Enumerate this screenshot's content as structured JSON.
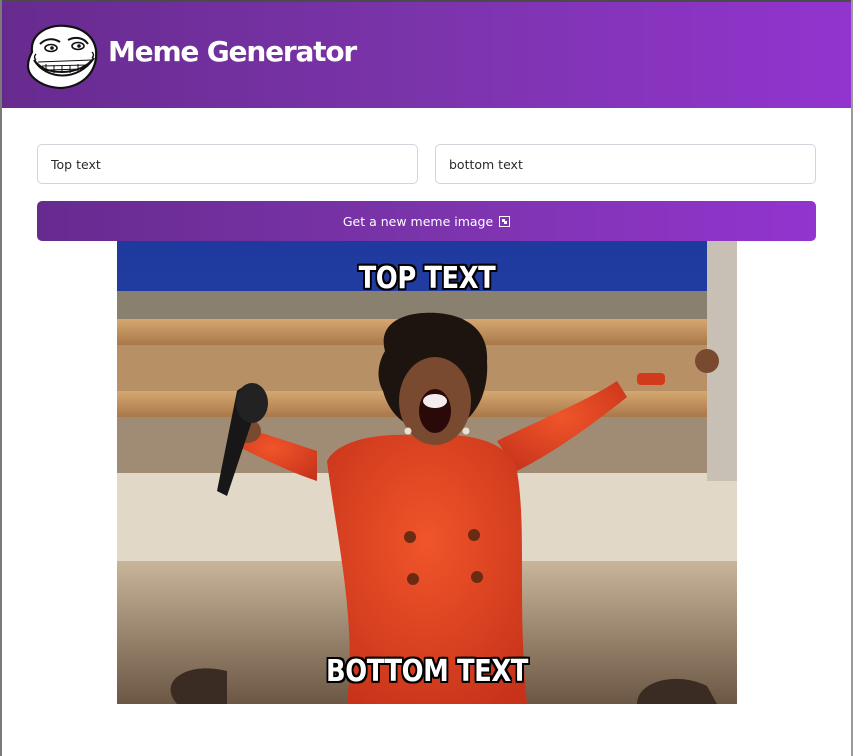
{
  "header": {
    "title": "Meme Generator",
    "logo_icon": "troll-face-icon",
    "gradient_start": "#672b8f",
    "gradient_end": "#9234cf"
  },
  "form": {
    "top_text_value": "Top text",
    "bottom_text_value": "bottom text",
    "button_label": "Get a new meme image",
    "button_icon": "frame-picture-icon"
  },
  "meme": {
    "top_text": "Top text",
    "bottom_text": "Bottom text"
  }
}
